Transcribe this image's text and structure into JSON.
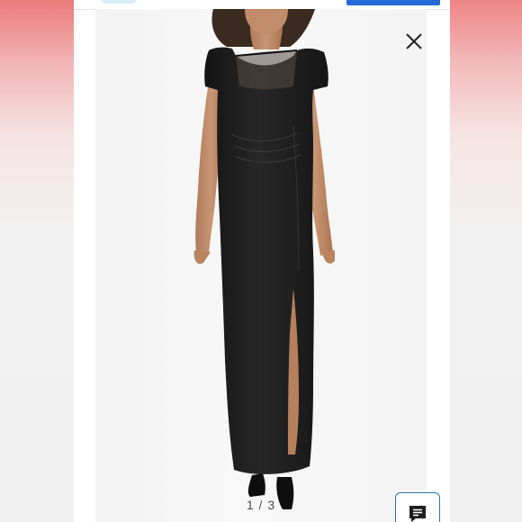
{
  "viewer": {
    "counter": "1 / 3"
  },
  "icons": {
    "close": "close-icon",
    "chat": "chat-icon"
  },
  "colors": {
    "accent_blue": "#2769d8",
    "chat_border": "#2e7aa3",
    "dress": "#1e1e1e",
    "background_pink": "#ec7f7f"
  }
}
